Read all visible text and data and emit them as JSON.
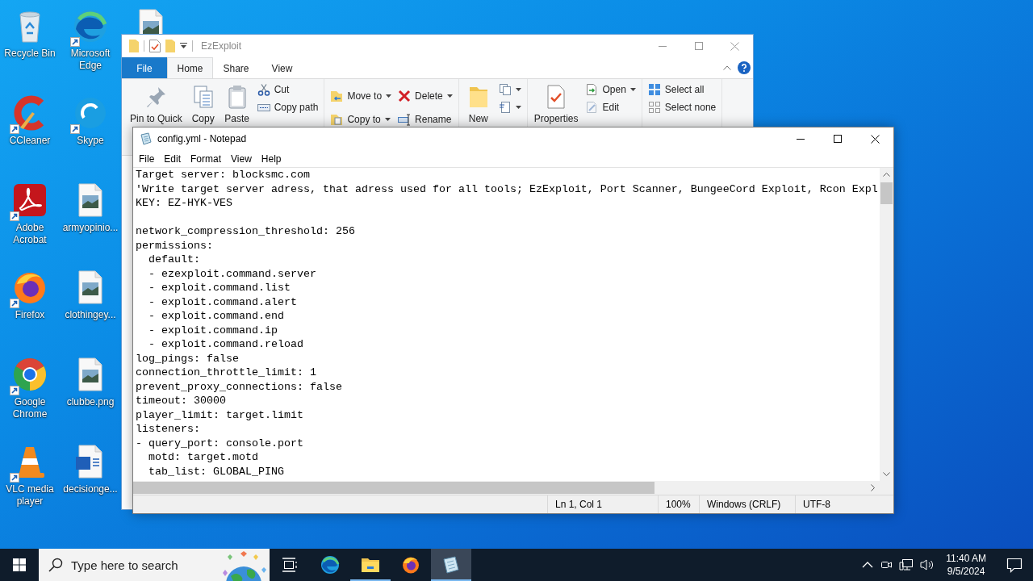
{
  "desktop": {
    "columns": [
      [
        {
          "label": "Recycle Bin",
          "shortcut": false
        },
        {
          "label": "CCleaner",
          "shortcut": true
        },
        {
          "label": "Adobe Acrobat",
          "shortcut": true
        },
        {
          "label": "Firefox",
          "shortcut": true
        },
        {
          "label": "Google Chrome",
          "shortcut": true
        },
        {
          "label": "VLC media player",
          "shortcut": true
        }
      ],
      [
        {
          "label": "Microsoft Edge",
          "shortcut": true
        },
        {
          "label": "Skype",
          "shortcut": true
        },
        {
          "label": "armyopinio...",
          "shortcut": false
        },
        {
          "label": "clothingey...",
          "shortcut": false
        },
        {
          "label": "clubbe.png",
          "shortcut": false
        },
        {
          "label": "decisionge...",
          "shortcut": false
        }
      ],
      [
        {
          "shortcut": false
        }
      ]
    ]
  },
  "explorer": {
    "title": "EzExploit",
    "tabs": [
      {
        "label": "File",
        "kind": "menu",
        "selected": false
      },
      {
        "label": "Home",
        "kind": "tab",
        "selected": true
      },
      {
        "label": "Share",
        "kind": "tab",
        "selected": false
      },
      {
        "label": "View",
        "kind": "tab",
        "selected": false
      }
    ],
    "ribbon": {
      "groups": [
        {
          "columns": [
            {
              "kind": "large",
              "items": [
                {
                  "label": "Pin to Quick",
                  "dropdown": false
                }
              ]
            },
            {
              "kind": "large",
              "items": [
                {
                  "label": "Copy",
                  "dropdown": false
                }
              ]
            },
            {
              "kind": "large",
              "items": [
                {
                  "label": "Paste",
                  "dropdown": false
                }
              ]
            },
            {
              "kind": "stack",
              "items": [
                {
                  "label": "Cut",
                  "dropdown": false
                },
                {
                  "label": "Copy path",
                  "dropdown": false
                }
              ]
            }
          ]
        },
        {
          "columns": [
            {
              "kind": "pair",
              "items": [
                {
                  "label": "Move to",
                  "dropdown": true
                },
                {
                  "label": "Copy to",
                  "dropdown": true
                }
              ]
            },
            {
              "kind": "pair",
              "items": [
                {
                  "label": "Delete",
                  "dropdown": true
                },
                {
                  "label": "Rename",
                  "dropdown": false
                }
              ]
            }
          ]
        },
        {
          "columns": [
            {
              "kind": "large",
              "items": [
                {
                  "label": "New",
                  "dropdown": false
                }
              ]
            },
            {
              "kind": "stack",
              "items": [
                {
                  "dropdown": true
                },
                {
                  "dropdown": true
                }
              ]
            }
          ]
        },
        {
          "columns": [
            {
              "kind": "large",
              "items": [
                {
                  "label": "Properties",
                  "dropdown": false
                }
              ]
            },
            {
              "kind": "stack",
              "items": [
                {
                  "label": "Open",
                  "dropdown": true
                },
                {
                  "label": "Edit",
                  "dropdown": false
                }
              ]
            }
          ]
        },
        {
          "columns": [
            {
              "kind": "stack",
              "items": [
                {
                  "label": "Select all",
                  "dropdown": false
                },
                {
                  "label": "Select none",
                  "dropdown": false
                }
              ]
            }
          ]
        }
      ]
    }
  },
  "notepad": {
    "title": "config.yml - Notepad",
    "menu": [
      "File",
      "Edit",
      "Format",
      "View",
      "Help"
    ],
    "text": "Target server: blocksmc.com\n'Write target server adress, that adress used for all tools; EzExploit, Port Scanner, BungeeCord Exploit, Rcon Expl\nKEY: EZ-HYK-VES\n\nnetwork_compression_threshold: 256\npermissions:\n  default:\n  - ezexploit.command.server\n  - exploit.command.list\n  - exploit.command.alert\n  - exploit.command.end\n  - exploit.command.ip\n  - exploit.command.reload\nlog_pings: false\nconnection_throttle_limit: 1\nprevent_proxy_connections: false\ntimeout: 30000\nplayer_limit: target.limit\nlisteners:\n- query_port: console.port\n  motd: target.motd\n  tab_list: GLOBAL_PING",
    "status": [
      "Ln 1, Col 1",
      "100%",
      "Windows (CRLF)",
      "UTF-8"
    ]
  },
  "taskbar": {
    "search": {
      "placeholder": "Type here to search"
    },
    "apps": [
      {
        "running": false,
        "active": false
      },
      {
        "running": true,
        "active": false
      },
      {
        "running": false,
        "active": false
      },
      {
        "running": true,
        "active": true
      }
    ],
    "clock": {
      "time": "11:40 AM",
      "date": "9/5/2024"
    }
  }
}
